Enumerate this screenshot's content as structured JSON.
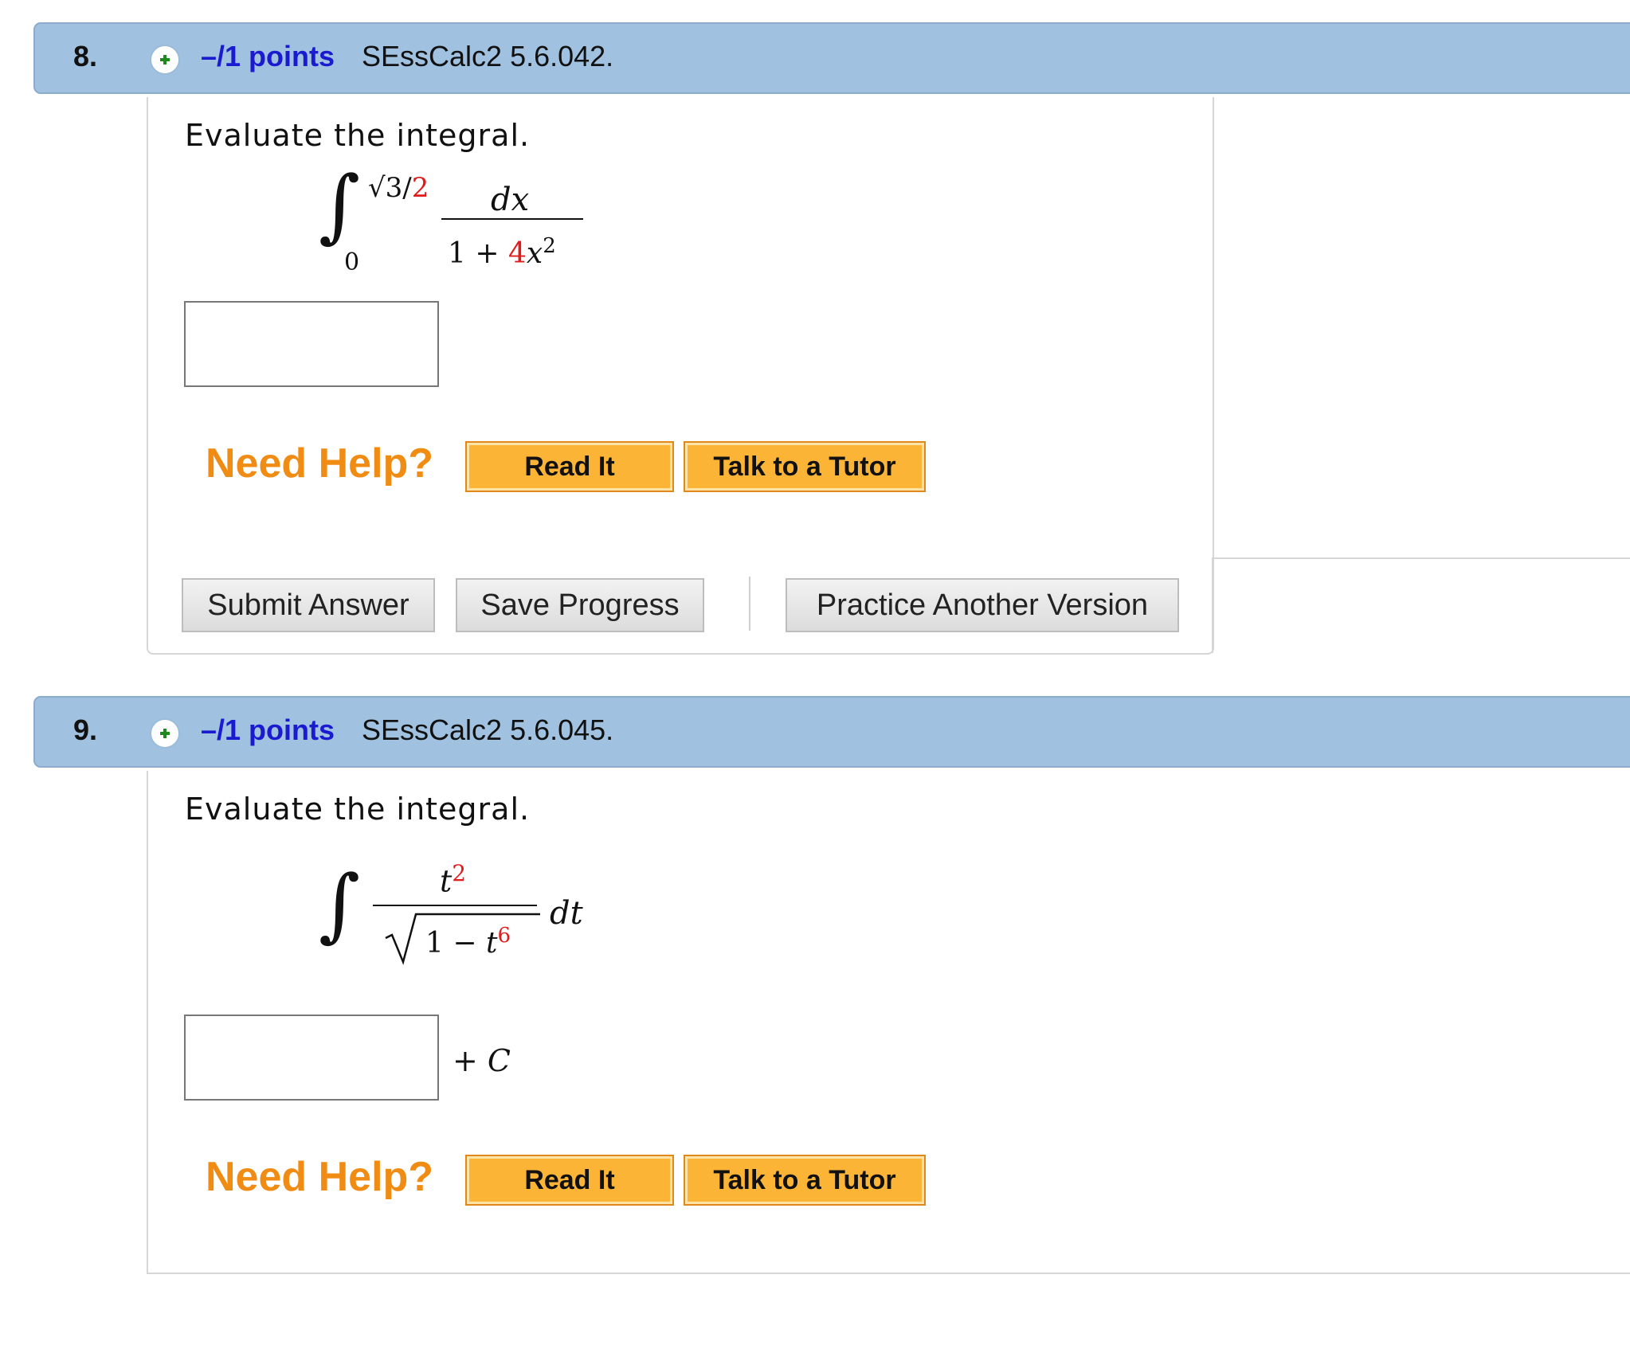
{
  "questions": [
    {
      "number": "8.",
      "points": "–/1 points",
      "id": "SEssCalc2 5.6.042.",
      "prompt": "Evaluate the integral.",
      "integral": {
        "upper_limit": "√3/",
        "upper_limit_red": "2",
        "lower_limit": "0",
        "numerator": "dx",
        "denominator_pre": "1 + ",
        "denominator_red": "4",
        "denominator_var": "x",
        "denominator_exp": "2"
      },
      "answer_value": "",
      "need_help": "Need Help?",
      "help_buttons": [
        "Read It",
        "Talk to a Tutor"
      ],
      "actions": {
        "submit": "Submit Answer",
        "save": "Save Progress",
        "practice": "Practice Another Version"
      }
    },
    {
      "number": "9.",
      "points": "–/1 points",
      "id": "SEssCalc2 5.6.045.",
      "prompt": "Evaluate the integral.",
      "integral": {
        "numerator_var": "t",
        "numerator_exp": "2",
        "radicand_pre": "1 − ",
        "radicand_var": "t",
        "radicand_exp": "6",
        "differential": "dt"
      },
      "answer_value": "",
      "constant": "+ C",
      "need_help": "Need Help?",
      "help_buttons": [
        "Read It",
        "Talk to a Tutor"
      ]
    }
  ],
  "colors": {
    "header_bg": "#a0c1df",
    "points_link": "#1a1ad0",
    "need_help": "#f08c14",
    "help_button": "#fbb436",
    "red_param": "#e01b1b"
  },
  "icons": [
    "plus-icon"
  ]
}
